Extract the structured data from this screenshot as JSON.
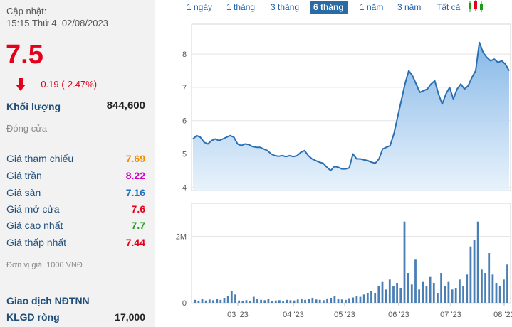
{
  "info": {
    "update_label": "Cập nhật:",
    "update_time": "15:15 Thứ 4, 02/08/2023",
    "price": "7.5",
    "change": "-0.19 (-2.47%)",
    "volume_label": "Khối lượng",
    "volume_value": "844,600",
    "status": "Đóng cửa",
    "rows": [
      {
        "label": "Giá tham chiếu",
        "value": "7.69",
        "color": "#f08c00"
      },
      {
        "label": "Giá trần",
        "value": "8.22",
        "color": "#d000c4"
      },
      {
        "label": "Giá sàn",
        "value": "7.16",
        "color": "#1f6fc0"
      },
      {
        "label": "Giá mở cửa",
        "value": "7.6",
        "color": "#e3001b"
      },
      {
        "label": "Giá cao nhất",
        "value": "7.7",
        "color": "#1a9e1a"
      },
      {
        "label": "Giá thấp nhất",
        "value": "7.44",
        "color": "#e3001b"
      }
    ],
    "unit_note": "Đơn vị giá: 1000 VNĐ",
    "foreign_title": "Giao dịch NĐTNN",
    "net_label": "KLGD ròng",
    "net_value": "17,000"
  },
  "ranges": [
    "1 ngày",
    "1 tháng",
    "3 tháng",
    "6 tháng",
    "1 năm",
    "3 năm",
    "Tất cả"
  ],
  "active_range": "6 tháng",
  "chart_data": [
    {
      "type": "area",
      "title": "",
      "y_ticks": [
        4,
        5,
        6,
        7,
        8
      ],
      "ylim": [
        3.9,
        8.9
      ],
      "x_ticks": [
        "03 '23",
        "04 '23",
        "05 '23",
        "06 '23",
        "07 '23",
        "08 '23"
      ],
      "series": [
        {
          "values": [
            5.45,
            5.55,
            5.5,
            5.35,
            5.3,
            5.4,
            5.45,
            5.4,
            5.45,
            5.5,
            5.55,
            5.5,
            5.3,
            5.25,
            5.3,
            5.28,
            5.22,
            5.2,
            5.2,
            5.15,
            5.1,
            5.0,
            4.95,
            4.93,
            4.95,
            4.92,
            4.95,
            4.92,
            4.95,
            5.05,
            5.1,
            4.95,
            4.85,
            4.8,
            4.75,
            4.72,
            4.6,
            4.5,
            4.62,
            4.6,
            4.55,
            4.55,
            4.58,
            5.0,
            4.85,
            4.85,
            4.82,
            4.8,
            4.75,
            4.72,
            4.85,
            5.15,
            5.2,
            5.25,
            5.6,
            6.1,
            6.6,
            7.1,
            7.5,
            7.35,
            7.1,
            6.85,
            6.9,
            6.95,
            7.1,
            7.2,
            6.8,
            6.5,
            6.8,
            7.0,
            6.65,
            6.95,
            7.1,
            6.95,
            7.05,
            7.3,
            7.5,
            8.35,
            8.05,
            7.9,
            7.8,
            7.85,
            7.75,
            7.8,
            7.7,
            7.5
          ],
          "color": "#2b6fb3"
        }
      ]
    },
    {
      "type": "bar",
      "title": "",
      "y_ticks": [
        0,
        2000000
      ],
      "y_tick_labels": [
        "0",
        "2M"
      ],
      "ylim": [
        0,
        3000000
      ],
      "series": [
        {
          "values": [
            90000,
            60000,
            110000,
            70000,
            100000,
            80000,
            120000,
            90000,
            150000,
            200000,
            350000,
            250000,
            70000,
            60000,
            80000,
            60000,
            180000,
            120000,
            90000,
            80000,
            110000,
            60000,
            70000,
            80000,
            60000,
            90000,
            80000,
            70000,
            100000,
            120000,
            90000,
            110000,
            150000,
            100000,
            90000,
            80000,
            130000,
            150000,
            200000,
            120000,
            100000,
            90000,
            140000,
            160000,
            200000,
            180000,
            250000,
            300000,
            350000,
            300000,
            500000,
            650000,
            400000,
            700000,
            500000,
            600000,
            450000,
            2450000,
            900000,
            550000,
            1300000,
            400000,
            650000,
            500000,
            800000,
            600000,
            300000,
            900000,
            500000,
            650000,
            400000,
            450000,
            700000,
            500000,
            850000,
            1700000,
            1900000,
            2450000,
            1000000,
            900000,
            1500000,
            850000,
            600000,
            500000,
            700000,
            1150000
          ],
          "color": "#4a7fb5"
        }
      ]
    }
  ]
}
